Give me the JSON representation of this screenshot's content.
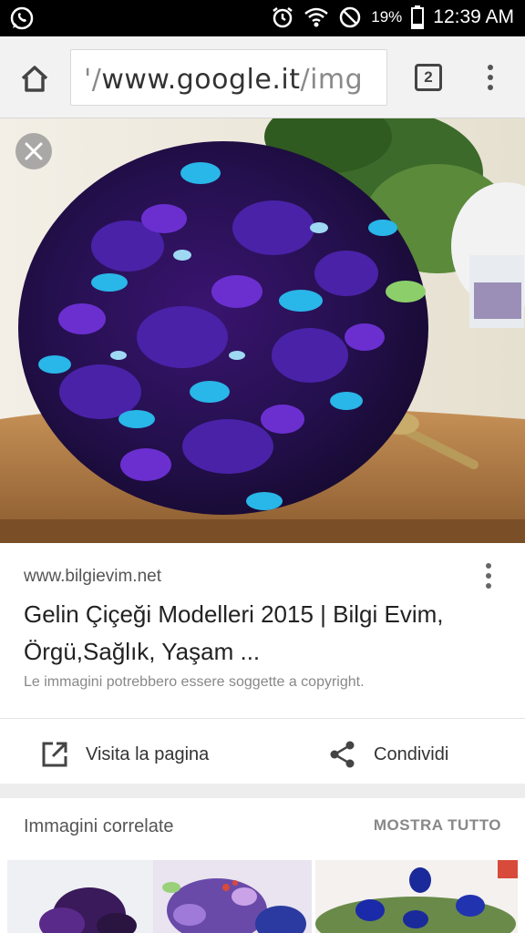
{
  "status_bar": {
    "battery": "19%",
    "time": "12:39 AM"
  },
  "browser": {
    "url_prefix": "'/",
    "url_domain": "www.google.it",
    "url_suffix": "/img",
    "tab_count": "2"
  },
  "result": {
    "source": "www.bilgievim.net",
    "title": "Gelin Çiçeği Modelleri 2015 | Bilgi Evim, Örgü,Sağlık, Yaşam ...",
    "copyright_notice": "Le immagini potrebbero essere soggette a copyright.",
    "visit_label": "Visita la pagina",
    "share_label": "Condividi"
  },
  "related": {
    "title": "Immagini correlate",
    "show_all_label": "MOSTRA TUTTO"
  }
}
